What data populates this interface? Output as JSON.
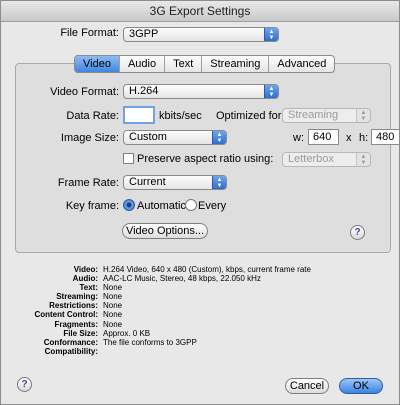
{
  "window": {
    "title": "3G Export Settings"
  },
  "file_format": {
    "label": "File Format:",
    "value": "3GPP"
  },
  "tabs": [
    {
      "label": "Video",
      "active": true
    },
    {
      "label": "Audio",
      "active": false
    },
    {
      "label": "Text",
      "active": false
    },
    {
      "label": "Streaming",
      "active": false
    },
    {
      "label": "Advanced",
      "active": false
    }
  ],
  "video": {
    "format_label": "Video Format:",
    "format_value": "H.264",
    "data_rate_label": "Data Rate:",
    "data_rate_value": "",
    "data_rate_unit": "kbits/sec",
    "optimized_label": "Optimized for:",
    "optimized_value": "Streaming",
    "image_size_label": "Image Size:",
    "image_size_value": "Custom",
    "w_label": "w:",
    "w_value": "640",
    "x_label": "x",
    "h_label": "h:",
    "h_value": "480",
    "preserve_label": "Preserve aspect ratio using:",
    "preserve_checked": false,
    "preserve_value": "Letterbox",
    "frame_rate_label": "Frame Rate:",
    "frame_rate_value": "Current",
    "key_frame_label": "Key frame:",
    "key_frame_automatic": "Automatic",
    "key_frame_every": "Every",
    "key_frame_selected": "Automatic",
    "options_button": "Video Options..."
  },
  "summary": [
    {
      "key": "Video:",
      "value": "H.264 Video, 640 x 480 (Custom),  kbps, current frame rate"
    },
    {
      "key": "Audio:",
      "value": "AAC-LC Music, Stereo, 48 kbps, 22.050 kHz"
    },
    {
      "key": "Text:",
      "value": "None"
    },
    {
      "key": "Streaming:",
      "value": "None"
    },
    {
      "key": "Restrictions:",
      "value": "None"
    },
    {
      "key": "Content Control:",
      "value": "None"
    },
    {
      "key": "Fragments:",
      "value": "None"
    },
    {
      "key": "File Size:",
      "value": "Approx. 0 KB"
    },
    {
      "key": "Conformance:",
      "value": "The file conforms to 3GPP"
    },
    {
      "key": "Compatibility:",
      "value": ""
    }
  ],
  "buttons": {
    "cancel": "Cancel",
    "ok": "OK",
    "help": "?"
  },
  "colors": {
    "accent": "#3c83e0",
    "help_glyph": "#5a39a8"
  }
}
